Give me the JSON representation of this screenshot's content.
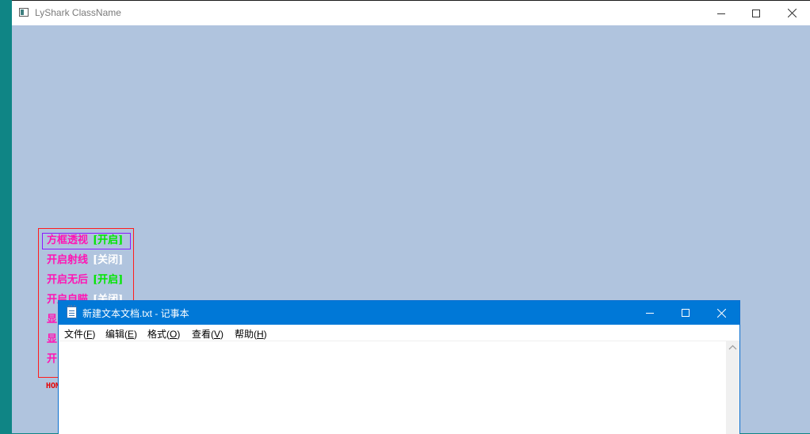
{
  "main_window": {
    "title": "LyShark ClassName"
  },
  "overlay_menu": {
    "items": [
      {
        "label": "方框透视",
        "status": "[开启]",
        "state": "on"
      },
      {
        "label": "开启射线",
        "status": "[关闭]",
        "state": "off"
      },
      {
        "label": "开启无后",
        "status": "[开启]",
        "state": "on"
      },
      {
        "label": "开启自瞄",
        "status": "[关闭]",
        "state": "off"
      },
      {
        "label": "显",
        "status": "",
        "state": "none"
      },
      {
        "label": "显",
        "status": "",
        "state": "none"
      },
      {
        "label": "开",
        "status": "",
        "state": "none"
      }
    ],
    "selected_index": 0,
    "hotkey_hint": "HOM"
  },
  "notepad": {
    "title": "新建文本文档.txt - 记事本",
    "menu": [
      {
        "label": "文件(",
        "accel": "F",
        "close": ")"
      },
      {
        "label": "编辑(",
        "accel": "E",
        "close": ")"
      },
      {
        "label": "格式(",
        "accel": "O",
        "close": ")"
      },
      {
        "label": "查看(",
        "accel": "V",
        "close": ")"
      },
      {
        "label": "帮助(",
        "accel": "H",
        "close": ")"
      }
    ],
    "content": ""
  },
  "colors": {
    "desktop": "#0f8585",
    "main_client": "#b0c4de",
    "menu_label": "#ff14b4",
    "status_on": "#00e600",
    "status_off": "#ffffff",
    "notepad_titlebar": "#0078d7"
  },
  "icons": {
    "main_app": "window-app-icon",
    "notepad_app": "notepad-icon"
  }
}
